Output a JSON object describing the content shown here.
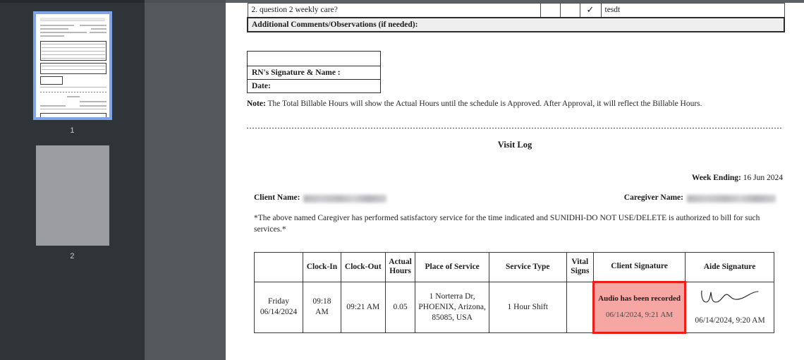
{
  "viewer": {
    "thumbnails": [
      {
        "label": "1",
        "selected": true,
        "state": "rendered"
      },
      {
        "label": "2",
        "selected": false,
        "state": "loading"
      }
    ]
  },
  "document": {
    "questions_table": {
      "rows": [
        {
          "question": "2. question 2 weekly care?",
          "col_a": "",
          "col_b": "",
          "check": "✓",
          "note": "tesdt"
        }
      ],
      "additional_comments_label": "Additional Comments/Observations (if needed):"
    },
    "rn_block": {
      "blank_row": "",
      "signature_label": "RN's Signature & Name :",
      "date_label": "Date:"
    },
    "note": {
      "prefix": "Note:",
      "text": " The Total Billable Hours will show the Actual Hours until the schedule is Approved. After Approval, it will reflect the Billable Hours."
    },
    "visit_log": {
      "title": "Visit Log",
      "week_ending_label": "Week Ending:",
      "week_ending_value": " 16 Jun 2024",
      "client_name_label": "Client Name:",
      "client_name_value": "",
      "caregiver_name_label": "Caregiver Name:",
      "caregiver_name_value": "",
      "attestation": "*The above named Caregiver has performed satisfactory service for the time indicated and SUNIDHI-DO NOT USE/DELETE is authorized to bill for such services.*",
      "columns": [
        "",
        "Clock-In",
        "Clock-Out",
        "Actual Hours",
        "Place of Service",
        "Service Type",
        "Vital Signs",
        "Client Signature",
        "Aide Signature"
      ],
      "rows": [
        {
          "day": "Friday",
          "date": "06/14/2024",
          "clock_in": "09:18 AM",
          "clock_out": "09:21 AM",
          "actual_hours": "0.05",
          "place_of_service": "1 Norterra Dr, PHOENIX, Arizona, 85085, USA",
          "service_type": "1 Hour Shift",
          "vital_signs": "",
          "client_signature_text": "Audio has been recorded",
          "client_signature_time": "06/14/2024, 9:21 AM",
          "aide_signature_time": "06/14/2024, 9:20 AM"
        }
      ]
    }
  },
  "colors": {
    "highlight_border": "#ef1d15",
    "highlight_fill": "#f6a6a3",
    "thumbnail_selected": "#7fa5e8",
    "sidebar_bg": "#2f3438",
    "gutter_bg": "#54585c"
  }
}
